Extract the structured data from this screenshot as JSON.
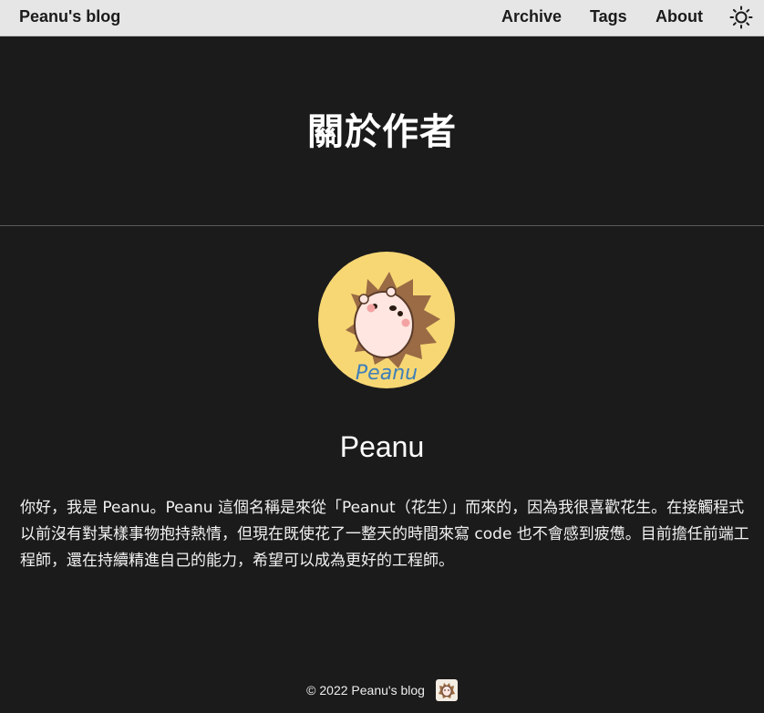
{
  "navbar": {
    "brand": "Peanu's blog",
    "links": [
      {
        "label": "Archive"
      },
      {
        "label": "Tags"
      },
      {
        "label": "About"
      }
    ],
    "theme_toggle_icon": "sun-icon"
  },
  "page": {
    "title": "關於作者"
  },
  "author": {
    "avatar_icon": "hedgehog-avatar-icon",
    "avatar_background": "#f7d774",
    "name": "Peanu",
    "bio": "你好，我是 Peanu。Peanu 這個名稱是來從「Peanut（花生）」而來的，因為我很喜歡花生。在接觸程式以前沒有對某樣事物抱持熱情，但現在既使花了一整天的時間來寫 code 也不會感到疲憊。目前擔任前端工程師，還在持續精進自己的能力，希望可以成為更好的工程師。"
  },
  "footer": {
    "copyright": "© 2022 Peanu's blog",
    "logo_icon": "hedgehog-logo-icon"
  },
  "colors": {
    "background": "#1b1b1b",
    "navbar_background": "#e6e6e6",
    "text": "#ffffff"
  }
}
